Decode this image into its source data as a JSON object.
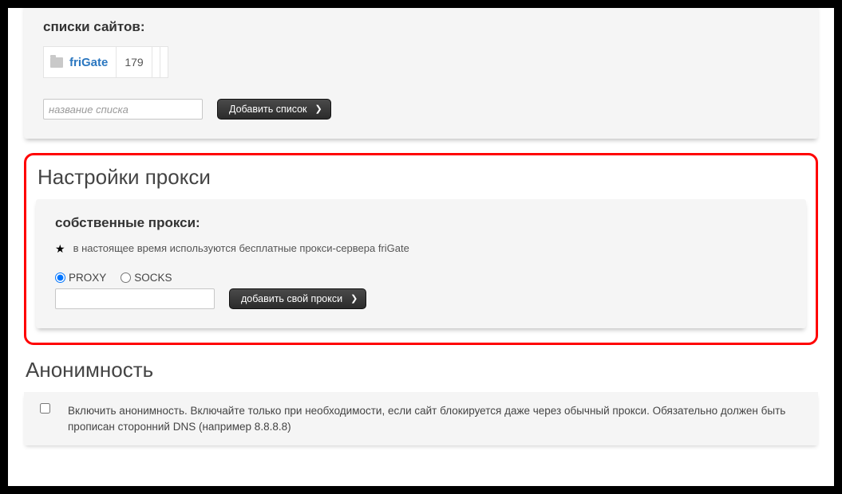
{
  "site_lists": {
    "title": "списки сайтов:",
    "items": [
      {
        "name": "friGate",
        "count": "179"
      }
    ],
    "new_list_placeholder": "название списка",
    "add_button": "Добавить список"
  },
  "proxy": {
    "section_title": "Настройки прокси",
    "own_proxy_title": "собственные прокси:",
    "note": "в настоящее время используются бесплатные прокси-сервера friGate",
    "radio_proxy": "PROXY",
    "radio_socks": "SOCKS",
    "add_proxy_button": "добавить свой прокси"
  },
  "anonymity": {
    "section_title": "Анонимность",
    "text": "Включить анонимность. Включайте только при необходимости, если сайт блокируется даже через обычный прокси. Обязательно должен быть прописан сторонний DNS (например 8.8.8.8)"
  }
}
